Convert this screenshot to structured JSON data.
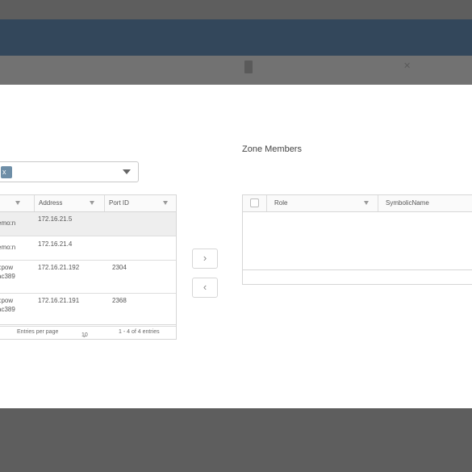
{
  "zone_members": {
    "title": "Zone Members"
  },
  "selector": {
    "chip_label": "x"
  },
  "left_table": {
    "columns": [
      "Address",
      "Port ID"
    ],
    "rows": [
      {
        "name": "emo:n",
        "name2": "",
        "address": "172.16.21.5",
        "port_id": ""
      },
      {
        "name": "emo:n",
        "name2": "",
        "address": "172.16.21.4",
        "port_id": ""
      },
      {
        "name": "t:pow",
        "name2": "ac389",
        "address": "172.16.21.192",
        "port_id": "2304"
      },
      {
        "name": "t:pow",
        "name2": "ac389",
        "address": "172.16.21.191",
        "port_id": "2368"
      }
    ],
    "footer": {
      "entries_per_page_label": "Entries per page",
      "entries_per_page_value": "10",
      "range_text": "1 - 4 of 4 entries"
    }
  },
  "right_table": {
    "columns": [
      "Role",
      "SymbolicName"
    ]
  },
  "buttons": {
    "move_right": "›",
    "move_left": "‹"
  }
}
